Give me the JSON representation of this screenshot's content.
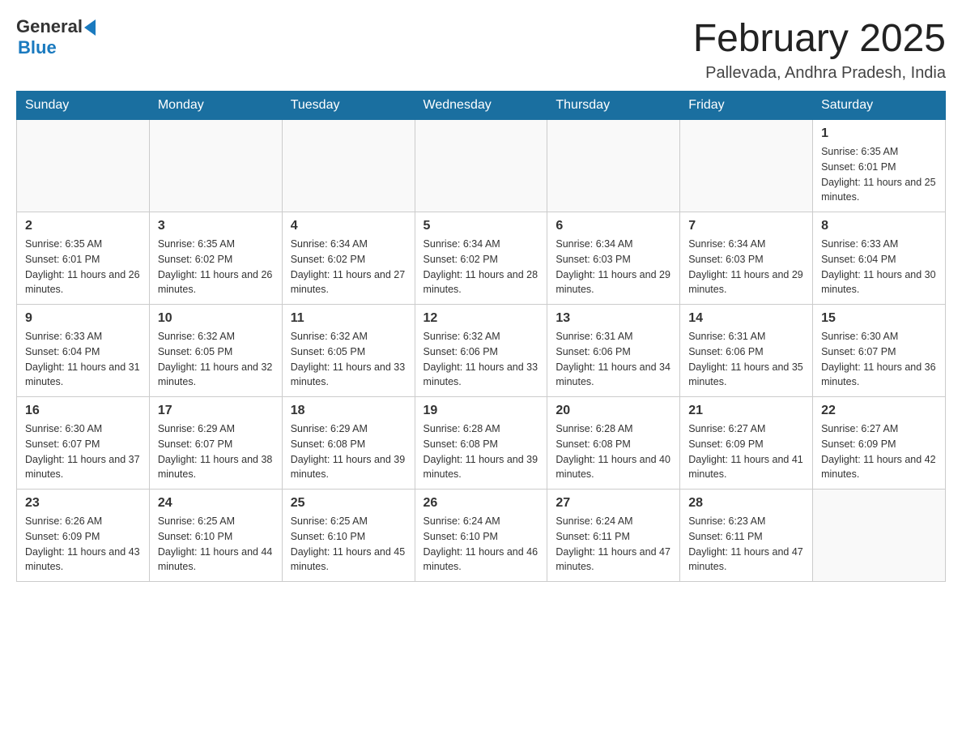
{
  "header": {
    "logo": {
      "general": "General",
      "blue": "Blue"
    },
    "title": "February 2025",
    "location": "Pallevada, Andhra Pradesh, India"
  },
  "days_of_week": [
    "Sunday",
    "Monday",
    "Tuesday",
    "Wednesday",
    "Thursday",
    "Friday",
    "Saturday"
  ],
  "weeks": [
    [
      {
        "day": "",
        "info": ""
      },
      {
        "day": "",
        "info": ""
      },
      {
        "day": "",
        "info": ""
      },
      {
        "day": "",
        "info": ""
      },
      {
        "day": "",
        "info": ""
      },
      {
        "day": "",
        "info": ""
      },
      {
        "day": "1",
        "info": "Sunrise: 6:35 AM\nSunset: 6:01 PM\nDaylight: 11 hours and 25 minutes."
      }
    ],
    [
      {
        "day": "2",
        "info": "Sunrise: 6:35 AM\nSunset: 6:01 PM\nDaylight: 11 hours and 26 minutes."
      },
      {
        "day": "3",
        "info": "Sunrise: 6:35 AM\nSunset: 6:02 PM\nDaylight: 11 hours and 26 minutes."
      },
      {
        "day": "4",
        "info": "Sunrise: 6:34 AM\nSunset: 6:02 PM\nDaylight: 11 hours and 27 minutes."
      },
      {
        "day": "5",
        "info": "Sunrise: 6:34 AM\nSunset: 6:02 PM\nDaylight: 11 hours and 28 minutes."
      },
      {
        "day": "6",
        "info": "Sunrise: 6:34 AM\nSunset: 6:03 PM\nDaylight: 11 hours and 29 minutes."
      },
      {
        "day": "7",
        "info": "Sunrise: 6:34 AM\nSunset: 6:03 PM\nDaylight: 11 hours and 29 minutes."
      },
      {
        "day": "8",
        "info": "Sunrise: 6:33 AM\nSunset: 6:04 PM\nDaylight: 11 hours and 30 minutes."
      }
    ],
    [
      {
        "day": "9",
        "info": "Sunrise: 6:33 AM\nSunset: 6:04 PM\nDaylight: 11 hours and 31 minutes."
      },
      {
        "day": "10",
        "info": "Sunrise: 6:32 AM\nSunset: 6:05 PM\nDaylight: 11 hours and 32 minutes."
      },
      {
        "day": "11",
        "info": "Sunrise: 6:32 AM\nSunset: 6:05 PM\nDaylight: 11 hours and 33 minutes."
      },
      {
        "day": "12",
        "info": "Sunrise: 6:32 AM\nSunset: 6:06 PM\nDaylight: 11 hours and 33 minutes."
      },
      {
        "day": "13",
        "info": "Sunrise: 6:31 AM\nSunset: 6:06 PM\nDaylight: 11 hours and 34 minutes."
      },
      {
        "day": "14",
        "info": "Sunrise: 6:31 AM\nSunset: 6:06 PM\nDaylight: 11 hours and 35 minutes."
      },
      {
        "day": "15",
        "info": "Sunrise: 6:30 AM\nSunset: 6:07 PM\nDaylight: 11 hours and 36 minutes."
      }
    ],
    [
      {
        "day": "16",
        "info": "Sunrise: 6:30 AM\nSunset: 6:07 PM\nDaylight: 11 hours and 37 minutes."
      },
      {
        "day": "17",
        "info": "Sunrise: 6:29 AM\nSunset: 6:07 PM\nDaylight: 11 hours and 38 minutes."
      },
      {
        "day": "18",
        "info": "Sunrise: 6:29 AM\nSunset: 6:08 PM\nDaylight: 11 hours and 39 minutes."
      },
      {
        "day": "19",
        "info": "Sunrise: 6:28 AM\nSunset: 6:08 PM\nDaylight: 11 hours and 39 minutes."
      },
      {
        "day": "20",
        "info": "Sunrise: 6:28 AM\nSunset: 6:08 PM\nDaylight: 11 hours and 40 minutes."
      },
      {
        "day": "21",
        "info": "Sunrise: 6:27 AM\nSunset: 6:09 PM\nDaylight: 11 hours and 41 minutes."
      },
      {
        "day": "22",
        "info": "Sunrise: 6:27 AM\nSunset: 6:09 PM\nDaylight: 11 hours and 42 minutes."
      }
    ],
    [
      {
        "day": "23",
        "info": "Sunrise: 6:26 AM\nSunset: 6:09 PM\nDaylight: 11 hours and 43 minutes."
      },
      {
        "day": "24",
        "info": "Sunrise: 6:25 AM\nSunset: 6:10 PM\nDaylight: 11 hours and 44 minutes."
      },
      {
        "day": "25",
        "info": "Sunrise: 6:25 AM\nSunset: 6:10 PM\nDaylight: 11 hours and 45 minutes."
      },
      {
        "day": "26",
        "info": "Sunrise: 6:24 AM\nSunset: 6:10 PM\nDaylight: 11 hours and 46 minutes."
      },
      {
        "day": "27",
        "info": "Sunrise: 6:24 AM\nSunset: 6:11 PM\nDaylight: 11 hours and 47 minutes."
      },
      {
        "day": "28",
        "info": "Sunrise: 6:23 AM\nSunset: 6:11 PM\nDaylight: 11 hours and 47 minutes."
      },
      {
        "day": "",
        "info": ""
      }
    ]
  ]
}
